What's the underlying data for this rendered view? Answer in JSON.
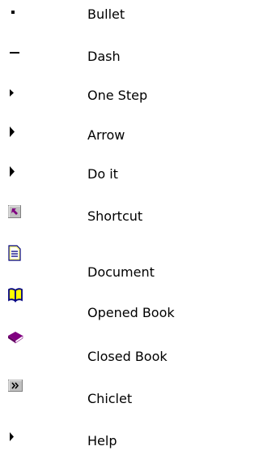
{
  "items": [
    {
      "id": "bullet",
      "label": "Bullet",
      "icon": "bullet-icon"
    },
    {
      "id": "dash",
      "label": "Dash",
      "icon": "dash-icon"
    },
    {
      "id": "one-step",
      "label": "One Step",
      "icon": "small-arrow-icon"
    },
    {
      "id": "arrow",
      "label": "Arrow",
      "icon": "arrow-icon"
    },
    {
      "id": "do-it",
      "label": "Do it",
      "icon": "arrow-icon"
    },
    {
      "id": "shortcut",
      "label": "Shortcut",
      "icon": "shortcut-icon"
    },
    {
      "id": "document",
      "label": "Document",
      "icon": "document-icon"
    },
    {
      "id": "opened-book",
      "label": "Opened Book",
      "icon": "opened-book-icon"
    },
    {
      "id": "closed-book",
      "label": "Closed Book",
      "icon": "closed-book-icon"
    },
    {
      "id": "chiclet",
      "label": "Chiclet",
      "icon": "chiclet-icon"
    },
    {
      "id": "help",
      "label": "Help",
      "icon": "arrow-icon"
    }
  ],
  "colors": {
    "text": "#000000",
    "shortcut_face": "#c0c0c0",
    "shortcut_arrow": "#800080",
    "document_accent": "#000080",
    "document_paper": "#ffffff",
    "book_fill": "#ffff00",
    "closed_book_fill": "#800080"
  }
}
